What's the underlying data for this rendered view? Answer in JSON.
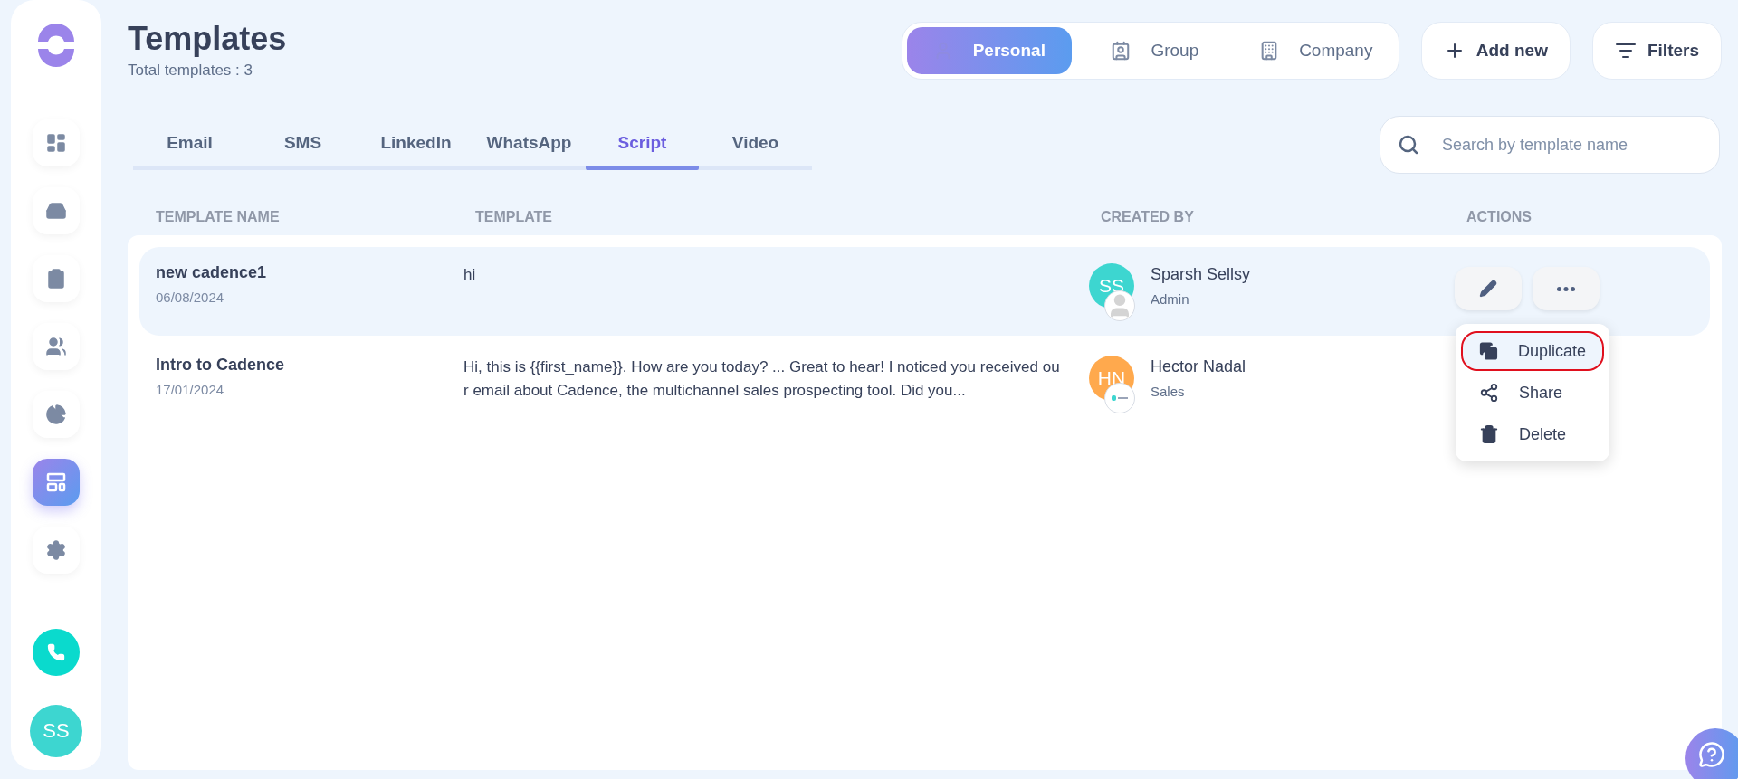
{
  "sidebar": {
    "nav_items": [
      {
        "selected": false
      },
      {
        "selected": false
      },
      {
        "selected": false
      },
      {
        "selected": false
      },
      {
        "selected": false
      },
      {
        "selected": true
      },
      {
        "selected": false
      }
    ],
    "user_avatar": "SS"
  },
  "header": {
    "title": "Templates",
    "subtitle": "Total templates : 3"
  },
  "scope_switch": [
    {
      "label": "Personal",
      "selected": true
    },
    {
      "label": "Group",
      "selected": false
    },
    {
      "label": "Company",
      "selected": false
    }
  ],
  "buttons": {
    "add_new": "Add new",
    "filters": "Filters"
  },
  "tabs": [
    {
      "label": "Email",
      "selected": false
    },
    {
      "label": "SMS",
      "selected": false
    },
    {
      "label": "LinkedIn",
      "selected": false
    },
    {
      "label": "WhatsApp",
      "selected": false
    },
    {
      "label": "Script",
      "selected": true
    },
    {
      "label": "Video",
      "selected": false
    }
  ],
  "search": {
    "placeholder": "Search by template name"
  },
  "table": {
    "columns": [
      "TEMPLATE NAME",
      "TEMPLATE",
      "CREATED BY",
      "ACTIONS"
    ],
    "rows": [
      {
        "name": "new cadence1",
        "date": "06/08/2024",
        "template": "hi",
        "creator": "Sparsh Sellsy",
        "initials": "SS",
        "role": "Admin",
        "kind": "silhouette",
        "color": "#3dd6d0",
        "selected": true
      },
      {
        "name": "Intro to Cadence",
        "date": "17/01/2024",
        "template": "Hi, this is {{first_name}}. How are you today? ... Great to hear! I noticed you received our email about Cadence, the multichannel sales prospecting tool. Did you...",
        "creator": "Hector Nadal",
        "initials": "HN",
        "role": "Sales",
        "kind": "logo",
        "color": "#ffa94d",
        "selected": false
      }
    ]
  },
  "actions_menu": [
    {
      "label": "Duplicate",
      "highlighted": true
    },
    {
      "label": "Share",
      "highlighted": false
    },
    {
      "label": "Delete",
      "highlighted": false
    }
  ]
}
